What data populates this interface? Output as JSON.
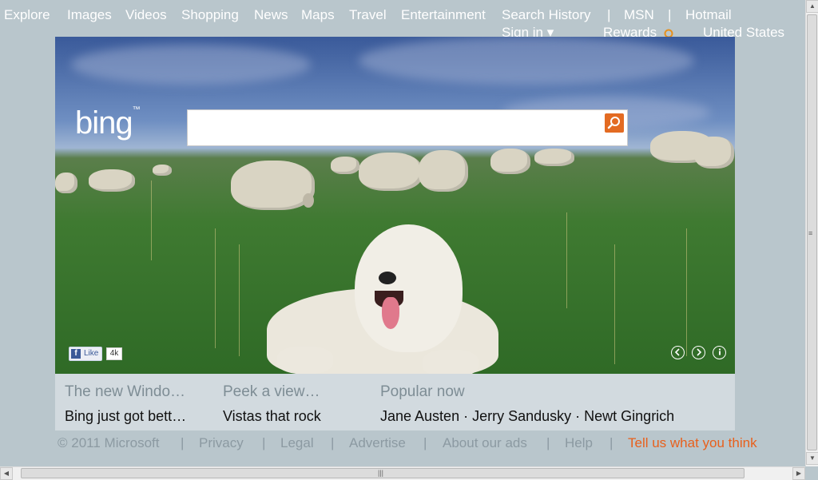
{
  "nav": {
    "explore": "Explore",
    "images": "Images",
    "videos": "Videos",
    "shopping": "Shopping",
    "news": "News",
    "maps": "Maps",
    "travel": "Travel",
    "entertainment": "Entertainment",
    "search_history": "Search History",
    "sep": "|",
    "msn": "MSN",
    "hotmail": "Hotmail",
    "sign_in": "Sign in ▾",
    "rewards": "Rewards",
    "country": "United States"
  },
  "logo": {
    "text": "bing",
    "tm": "™"
  },
  "search": {
    "value": "",
    "placeholder": ""
  },
  "hero": {
    "like_label": "Like",
    "like_count": "4k"
  },
  "tiles": [
    {
      "title": "The new Windo…",
      "subtitle": "Bing just got bett…"
    },
    {
      "title": "Peek a view…",
      "subtitle": "Vistas that rock"
    },
    {
      "title": "Popular now",
      "items": [
        "Jane Austen",
        "Jerry Sandusky",
        "Newt Gingrich"
      ],
      "dot": " · "
    }
  ],
  "footer": {
    "copyright": "© 2011 Microsoft",
    "privacy": "Privacy",
    "legal": "Legal",
    "advertise": "Advertise",
    "about_ads": "About our ads",
    "help": "Help",
    "feedback": "Tell us what you think",
    "sep": "|"
  },
  "colors": {
    "page_bg": "#b9c6cc",
    "accent_orange": "#e8601c",
    "search_button": "#e36b22",
    "panel_bg": "#d2dadf"
  },
  "icons": {
    "search": "magnifier-icon",
    "rewards": "rewards-badge-icon",
    "prev": "chevron-left-icon",
    "next": "chevron-right-icon",
    "info": "info-icon",
    "facebook": "facebook-icon"
  }
}
